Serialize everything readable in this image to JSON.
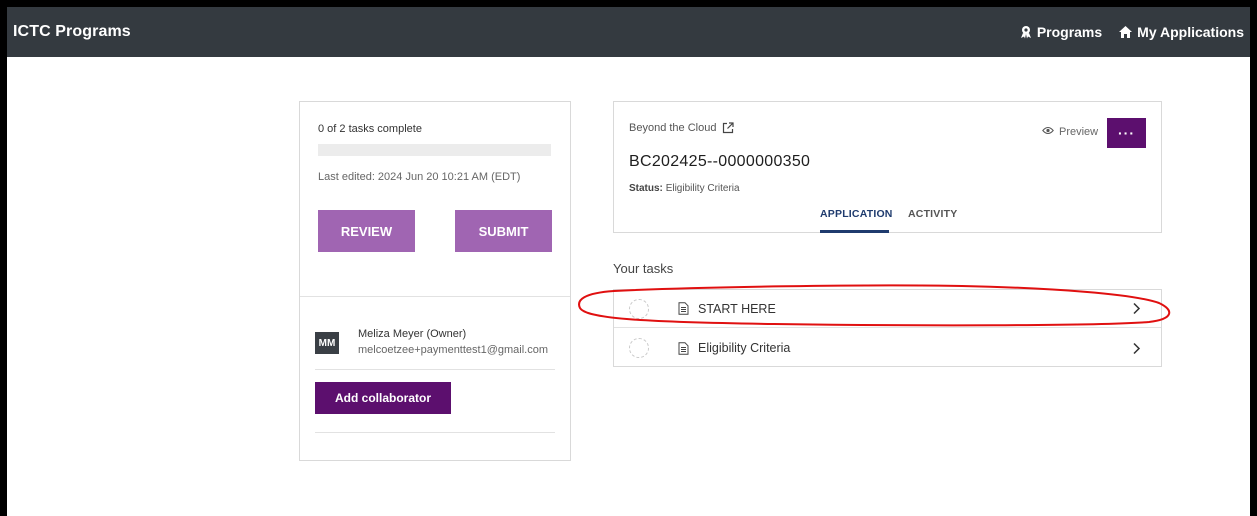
{
  "header": {
    "brand": "ICTC Programs",
    "nav": [
      {
        "label": "Programs",
        "icon": "award-icon"
      },
      {
        "label": "My Applications",
        "icon": "home-icon"
      }
    ]
  },
  "summary": {
    "tasks_complete": "0 of 2 tasks complete",
    "progress_fraction": 0,
    "last_edited": "Last edited: 2024 Jun 20 10:21 AM (EDT)",
    "review_label": "REVIEW",
    "submit_label": "SUBMIT"
  },
  "collaborators": {
    "members": [
      {
        "initials": "MM",
        "name": "Meliza Meyer (Owner)",
        "email": "melcoetzee+paymenttest1@gmail.com"
      }
    ],
    "add_label": "Add collaborator"
  },
  "application": {
    "program_name": "Beyond the Cloud",
    "program_icon": "external-link-icon",
    "preview_label": "Preview",
    "more_label": "···",
    "id": "BC202425--0000000350",
    "status_label": "Status:",
    "status_value": "Eligibility Criteria",
    "tabs": [
      "APPLICATION",
      "ACTIVITY"
    ],
    "active_tab": "APPLICATION"
  },
  "tasks": {
    "heading": "Your tasks",
    "items": [
      {
        "label": "START HERE",
        "icon": "document-icon"
      },
      {
        "label": "Eligibility Criteria",
        "icon": "document-icon"
      }
    ]
  },
  "colors": {
    "topbar": "#343a40",
    "accent": "#5c0f6e",
    "accent_light": "#a065b2",
    "tab_active": "#1f3b6e",
    "annotation": "#e01010"
  }
}
